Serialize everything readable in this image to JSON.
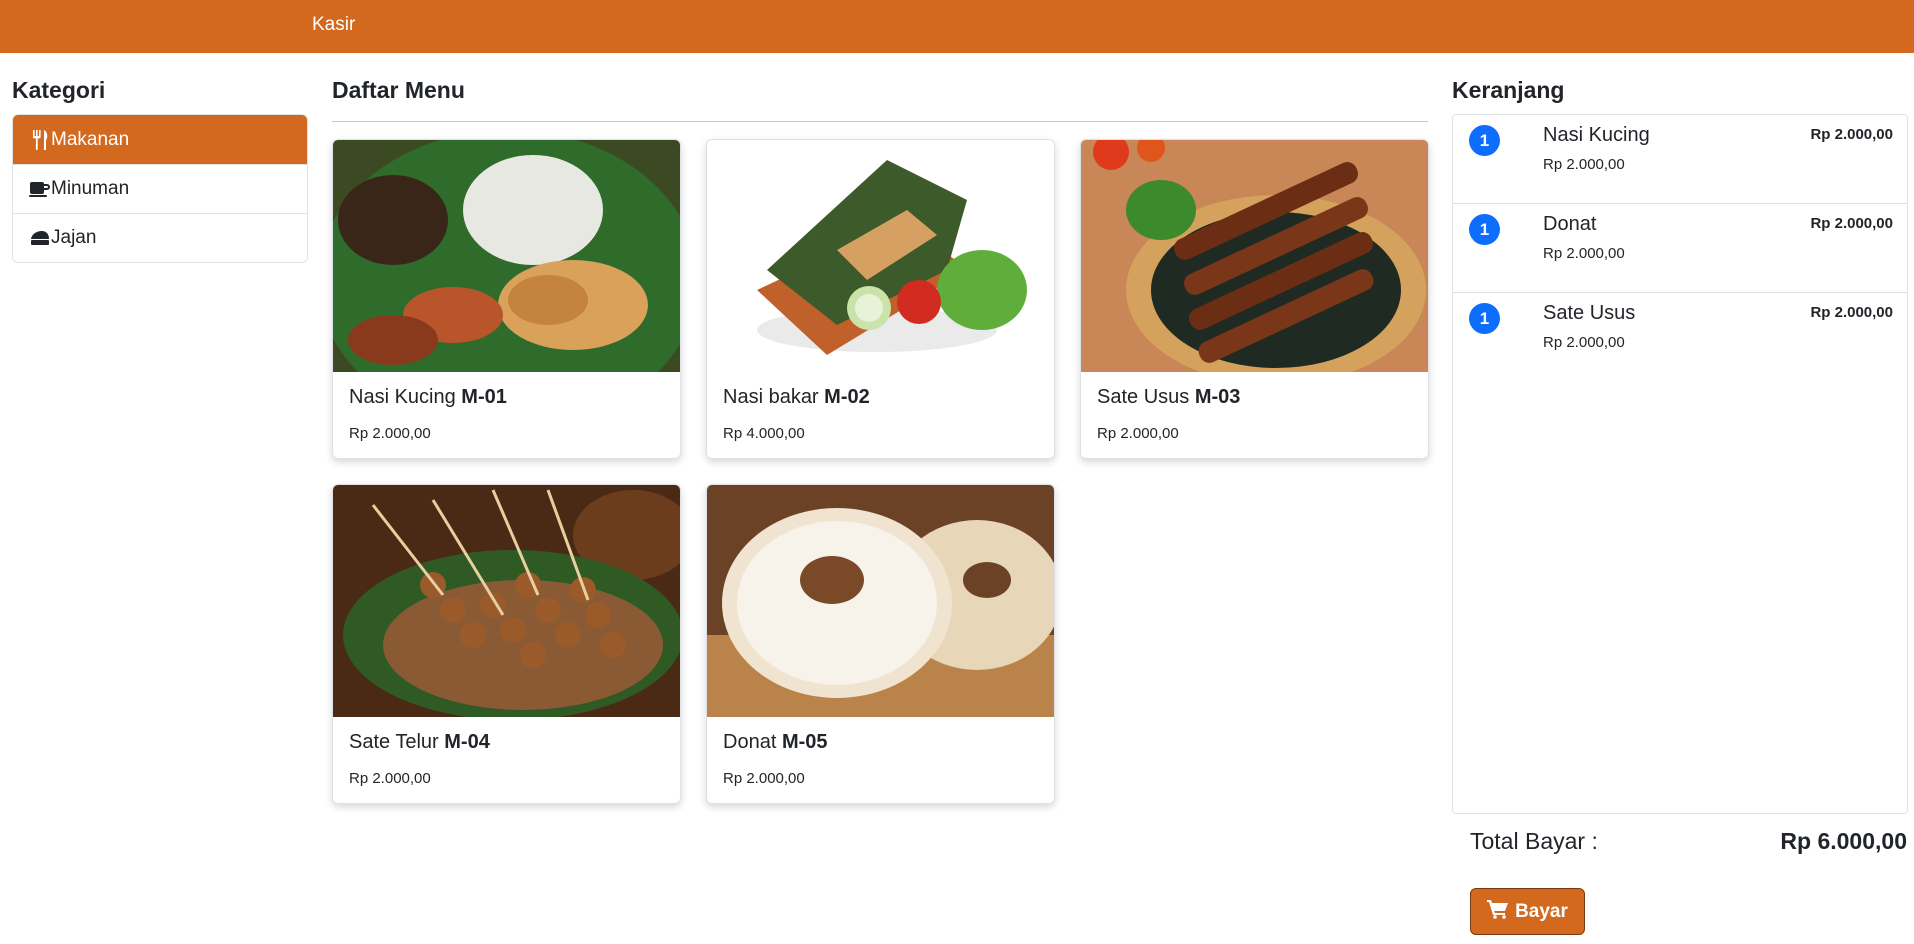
{
  "navbar": {
    "brand": "Kasir"
  },
  "kategori": {
    "title": "Kategori",
    "items": [
      {
        "label": "Makanan",
        "icon": "utensils-icon",
        "active": true
      },
      {
        "label": "Minuman",
        "icon": "mug-icon",
        "active": false
      },
      {
        "label": "Jajan",
        "icon": "cake-icon",
        "active": false
      }
    ]
  },
  "menu": {
    "title": "Daftar Menu",
    "items": [
      {
        "name": "Nasi Kucing",
        "code": "M-01",
        "price": "Rp 2.000,00"
      },
      {
        "name": "Nasi bakar",
        "code": "M-02",
        "price": "Rp 4.000,00"
      },
      {
        "name": "Sate Usus",
        "code": "M-03",
        "price": "Rp 2.000,00"
      },
      {
        "name": "Sate Telur",
        "code": "M-04",
        "price": "Rp 2.000,00"
      },
      {
        "name": "Donat",
        "code": "M-05",
        "price": "Rp 2.000,00"
      }
    ]
  },
  "cart": {
    "title": "Keranjang",
    "items": [
      {
        "qty": "1",
        "name": "Nasi Kucing",
        "unit_price": "Rp 2.000,00",
        "subtotal": "Rp 2.000,00"
      },
      {
        "qty": "1",
        "name": "Donat",
        "unit_price": "Rp 2.000,00",
        "subtotal": "Rp 2.000,00"
      },
      {
        "qty": "1",
        "name": "Sate Usus",
        "unit_price": "Rp 2.000,00",
        "subtotal": "Rp 2.000,00"
      }
    ],
    "total_label": "Total Bayar :",
    "total_value": "Rp 6.000,00",
    "pay_label": "Bayar",
    "pay_icon": "cart-icon"
  },
  "colors": {
    "accent": "#d2691e",
    "badge": "#0d6efd"
  }
}
